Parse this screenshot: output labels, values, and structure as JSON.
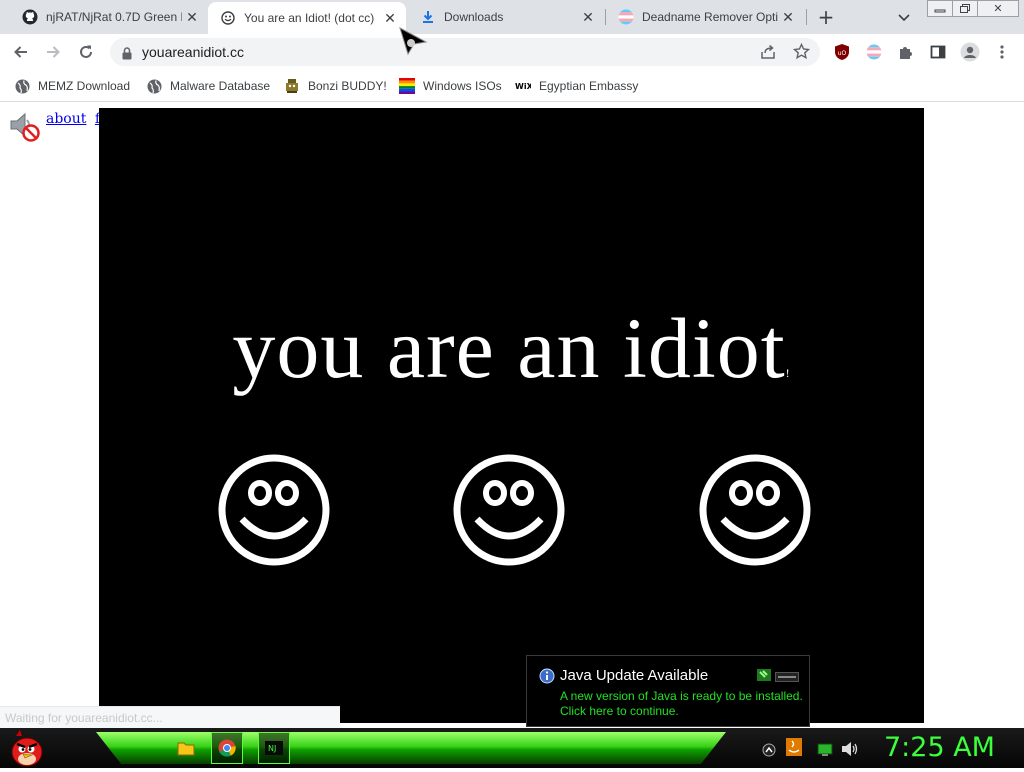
{
  "browser": {
    "tabs": [
      {
        "title": "njRAT/NjRat 0.7D Green E",
        "icon": "github-icon",
        "active": false
      },
      {
        "title": "You are an Idiot! (dot cc)",
        "icon": "smiley-icon",
        "active": true
      },
      {
        "title": "Downloads",
        "icon": "download-icon",
        "active": false
      },
      {
        "title": "Deadname Remover Opti",
        "icon": "trans-flag-icon",
        "active": false
      }
    ],
    "new_tab_label": "+",
    "url": "youareanidiot.cc",
    "bookmarks": [
      {
        "label": "MEMZ Download",
        "icon": "globe-icon"
      },
      {
        "label": "Malware Database",
        "icon": "globe-icon"
      },
      {
        "label": "Bonzi BUDDY!",
        "icon": "bonzi-icon"
      },
      {
        "label": "Windows ISOs",
        "icon": "windows-icon"
      },
      {
        "label": "Egyptian Embassy",
        "icon": "wix-icon"
      }
    ],
    "status_text": "Waiting for youareanidiot.cc..."
  },
  "page": {
    "links": [
      "about",
      "flash"
    ],
    "headline": "you are an idiot",
    "headline_suffix": "!",
    "smiley_count": 3
  },
  "java_popup": {
    "title": "Java Update Available",
    "line1": "A new version of Java is ready to be installed.",
    "line2": "Click here to continue."
  },
  "taskbar": {
    "clock": "7:25 AM",
    "pinned": [
      "folder-icon",
      "chrome-icon",
      "njrat-icon"
    ]
  },
  "colors": {
    "tabstrip": "#dee1e6",
    "stage": "#000000",
    "taskbar_green": "#38d218",
    "clock": "#3aff3a",
    "java_text": "#22e022"
  }
}
